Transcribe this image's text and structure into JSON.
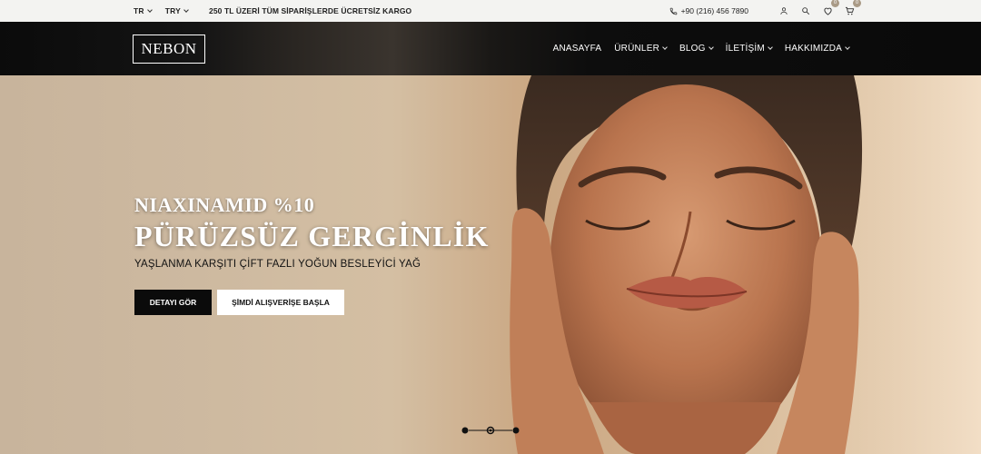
{
  "topbar": {
    "language": "TR",
    "currency": "TRY",
    "promo": "250 TL ÜZERİ TÜM SİPARİŞLERDE ÜCRETSİZ KARGO",
    "phone": "+90 (216) 456 7890",
    "wishlist_count": "0",
    "cart_count": "0"
  },
  "header": {
    "logo": "NEBON",
    "nav": [
      {
        "label": "ANASAYFA"
      },
      {
        "label": "ÜRÜNLER"
      },
      {
        "label": "BLOG"
      },
      {
        "label": "İLETİŞİM"
      },
      {
        "label": "HAKKIMIZDA"
      }
    ]
  },
  "hero": {
    "subtitle": "NIAXINAMID %10",
    "title": "PÜRÜZSÜZ GERGİNLİK",
    "description": "YAŞLANMA KARŞITI ÇİFT FAZLI YOĞUN BESLEYİCİ YAĞ",
    "primary_button": "DETAYI GÖR",
    "secondary_button": "ŞİMDİ ALIŞVERİŞE BAŞLA",
    "slides_total": 3,
    "active_slide": 2
  },
  "colors": {
    "header_bg": "#0b0b0b",
    "badge": "#a99a86",
    "topbar_bg": "#f3f3f1"
  }
}
